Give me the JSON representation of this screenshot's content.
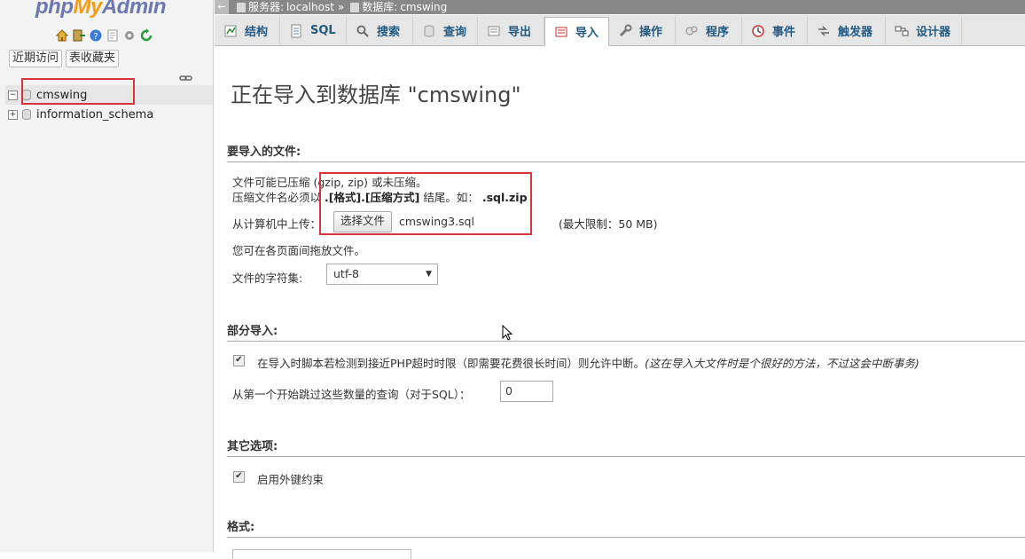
{
  "nav": {
    "logo": {
      "part1": "php",
      "part2": "My",
      "part3": "Admin"
    },
    "icons": [
      "home-icon",
      "exit-icon",
      "help-icon",
      "docs-icon",
      "settings-icon",
      "reload-icon"
    ],
    "tabs": {
      "recent": "近期访问",
      "favorites": "表收藏夹"
    },
    "databases": [
      {
        "name": "cmswing",
        "expanded": true,
        "selected": true
      },
      {
        "name": "information_schema",
        "expanded": false,
        "selected": false
      }
    ]
  },
  "breadcrumb": {
    "server_label": "服务器:",
    "server": "localhost",
    "separator": "»",
    "db_label": "数据库:",
    "db": "cmswing"
  },
  "tabs": [
    {
      "label": "结构",
      "icon": "structure-icon"
    },
    {
      "label": "SQL",
      "icon": "sql-icon"
    },
    {
      "label": "搜索",
      "icon": "search-icon"
    },
    {
      "label": "查询",
      "icon": "query-icon"
    },
    {
      "label": "导出",
      "icon": "export-icon"
    },
    {
      "label": "导入",
      "icon": "import-icon",
      "active": true
    },
    {
      "label": "操作",
      "icon": "wrench-icon"
    },
    {
      "label": "程序",
      "icon": "routines-icon"
    },
    {
      "label": "事件",
      "icon": "clock-icon"
    },
    {
      "label": "触发器",
      "icon": "triggers-icon"
    },
    {
      "label": "设计器",
      "icon": "designer-icon"
    }
  ],
  "main": {
    "title": "正在导入到数据库 \"cmswing\"",
    "file_section": {
      "heading": "要导入的文件:",
      "compress_note": "文件可能已压缩 (gzip, zip) 或未压缩。",
      "name_note_prefix": "压缩文件名必须以",
      "name_note_format": ".[格式].[压缩方式]",
      "name_note_mid": "结尾。如：",
      "name_note_example": ".sql.zip",
      "upload_label": "从计算机中上传：",
      "choose_button": "选择文件",
      "file_name": "cmswing3.sql",
      "max_size": "(最大限制：50 MB)",
      "drag_note": "您可在各页面间拖放文件。",
      "charset_label": "文件的字符集:",
      "charset_value": "utf-8"
    },
    "partial_section": {
      "heading": "部分导入:",
      "interrupt_label": "在导入时脚本若检测到接近PHP超时时限（即需要花费很长时间）则允许中断。",
      "interrupt_hint": "(这在导入大文件时是个很好的方法，不过这会中断事务)",
      "interrupt_checked": true,
      "skip_label": "从第一个开始跳过这些数量的查询（对于SQL）：",
      "skip_value": "0"
    },
    "other_section": {
      "heading": "其它选项:",
      "fk_label": "启用外键约束",
      "fk_checked": true
    },
    "format_section": {
      "heading": "格式:"
    }
  },
  "colors": {
    "accent_red": "#d9333f",
    "link_blue": "#235a81",
    "breadcrumb_bg": "#888888"
  }
}
